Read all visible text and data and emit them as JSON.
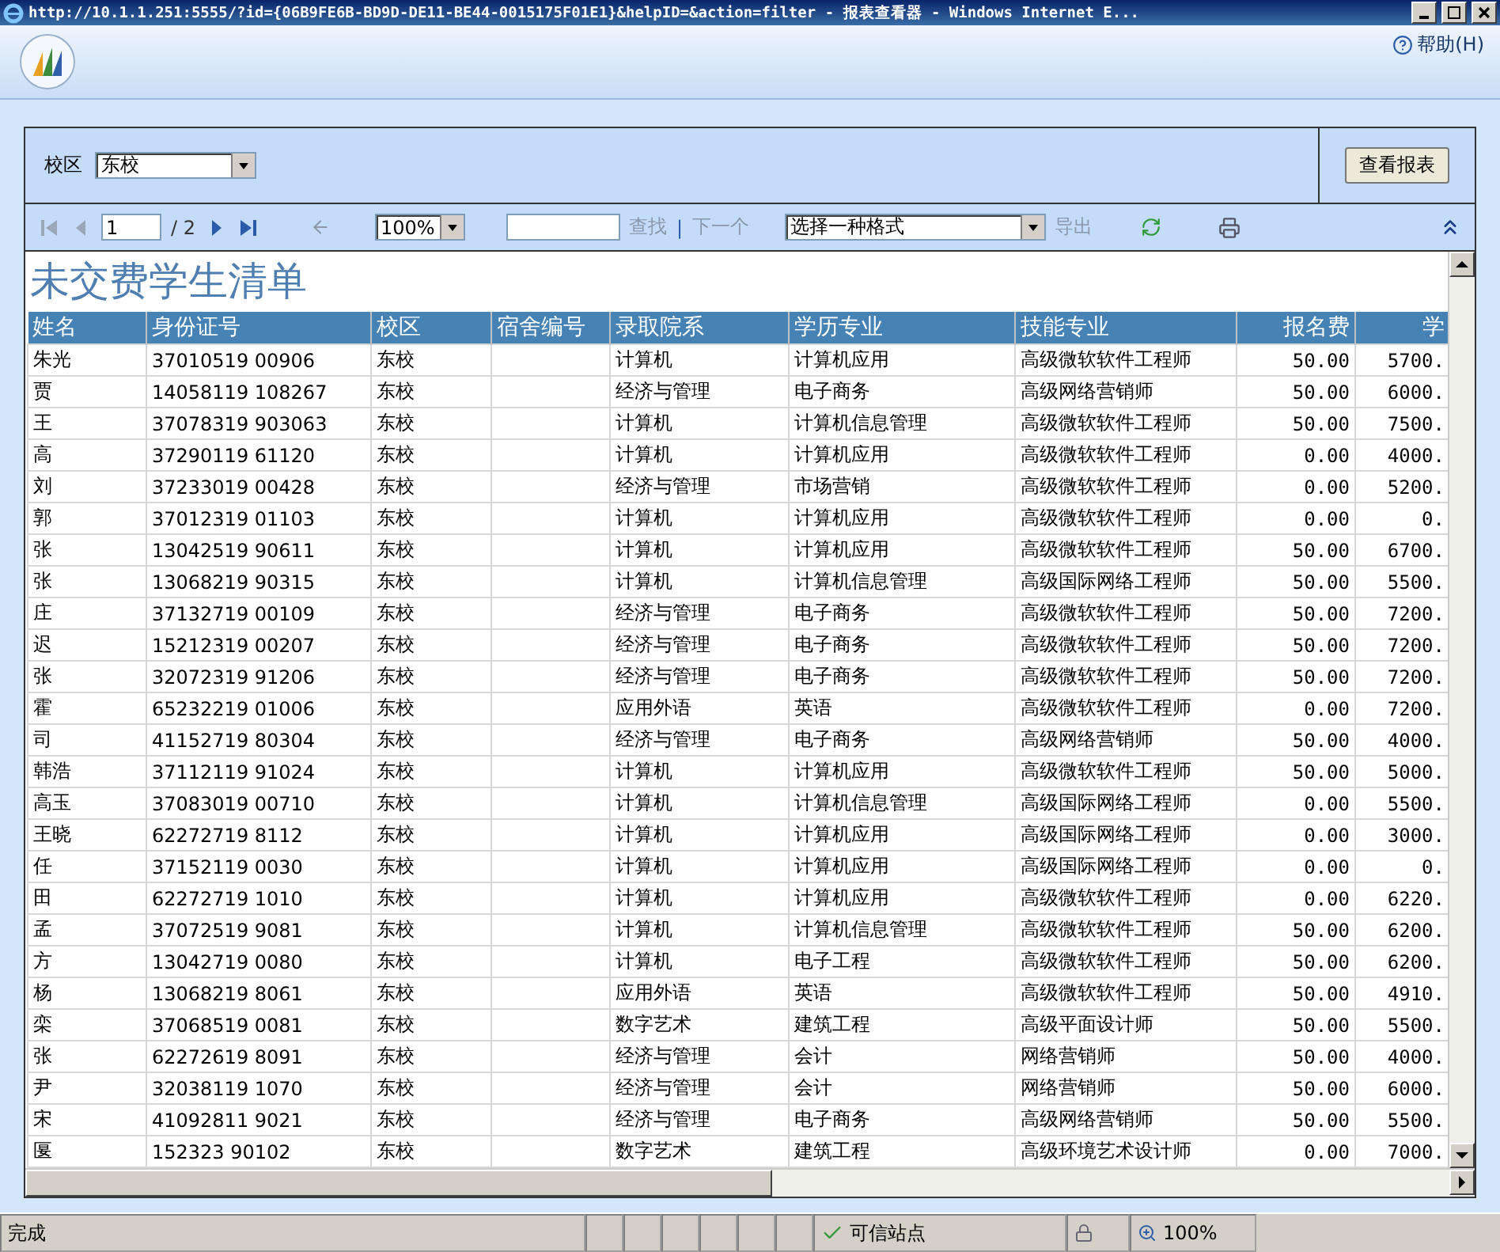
{
  "window": {
    "title": "http://10.1.1.251:5555/?id={06B9FE6B-BD9D-DE11-BE44-0015175F01E1}&helpID=&action=filter - 报表查看器 - Windows Internet E..."
  },
  "header": {
    "help": "帮助(H)"
  },
  "parameters": {
    "label": "校区",
    "value": "东校",
    "button": "查看报表"
  },
  "toolbar": {
    "page": "1",
    "page_total": "/ 2",
    "zoom": "100%",
    "find": "查找",
    "separator": "|",
    "find_next": "下一个",
    "format": "选择一种格式",
    "export": "导出",
    "nav": [
      {
        "kind": "first",
        "disabled": true
      },
      {
        "kind": "prev",
        "disabled": true
      },
      {
        "kind": "next",
        "disabled": false
      },
      {
        "kind": "last",
        "disabled": false
      }
    ]
  },
  "report": {
    "title": "未交费学生清单",
    "columns": [
      {
        "label": "姓名",
        "kind": "text"
      },
      {
        "label": "身份证号",
        "kind": "text"
      },
      {
        "label": "校区",
        "kind": "text"
      },
      {
        "label": "宿舍编号",
        "kind": "text"
      },
      {
        "label": "录取院系",
        "kind": "text"
      },
      {
        "label": "学历专业",
        "kind": "text"
      },
      {
        "label": "技能专业",
        "kind": "text"
      },
      {
        "label": "报名费",
        "kind": "numeric"
      },
      {
        "label": "学",
        "kind": "numeric"
      }
    ],
    "rows": [
      {
        "cells": [
          "朱光",
          "37010519 00906",
          "东校",
          "",
          "计算机",
          "计算机应用",
          "高级微软软件工程师",
          "50.00",
          "5700."
        ]
      },
      {
        "cells": [
          "贾",
          "14058119 108267",
          "东校",
          "",
          "经济与管理",
          "电子商务",
          "高级网络营销师",
          "50.00",
          "6000."
        ]
      },
      {
        "cells": [
          "王",
          "37078319 903063",
          "东校",
          "",
          "计算机",
          "计算机信息管理",
          "高级微软软件工程师",
          "50.00",
          "7500."
        ]
      },
      {
        "cells": [
          "高",
          "37290119 61120",
          "东校",
          "",
          "计算机",
          "计算机应用",
          "高级微软软件工程师",
          "0.00",
          "4000."
        ]
      },
      {
        "cells": [
          "刘",
          "37233019 00428",
          "东校",
          "",
          "经济与管理",
          "市场营销",
          "高级微软软件工程师",
          "0.00",
          "5200."
        ]
      },
      {
        "cells": [
          "郭",
          "37012319 01103",
          "东校",
          "",
          "计算机",
          "计算机应用",
          "高级微软软件工程师",
          "0.00",
          "0."
        ]
      },
      {
        "cells": [
          "张",
          "13042519 90611",
          "东校",
          "",
          "计算机",
          "计算机应用",
          "高级微软软件工程师",
          "50.00",
          "6700."
        ]
      },
      {
        "cells": [
          "张",
          "13068219 90315",
          "东校",
          "",
          "计算机",
          "计算机信息管理",
          "高级国际网络工程师",
          "50.00",
          "5500."
        ]
      },
      {
        "cells": [
          "庄",
          "37132719 00109",
          "东校",
          "",
          "经济与管理",
          "电子商务",
          "高级微软软件工程师",
          "50.00",
          "7200."
        ]
      },
      {
        "cells": [
          "迟",
          "15212319 00207",
          "东校",
          "",
          "经济与管理",
          "电子商务",
          "高级微软软件工程师",
          "50.00",
          "7200."
        ]
      },
      {
        "cells": [
          "张",
          "32072319 91206",
          "东校",
          "",
          "经济与管理",
          "电子商务",
          "高级微软软件工程师",
          "50.00",
          "7200."
        ]
      },
      {
        "cells": [
          "霍",
          "65232219 01006",
          "东校",
          "",
          "应用外语",
          "英语",
          "高级微软软件工程师",
          "0.00",
          "7200."
        ]
      },
      {
        "cells": [
          "司",
          "41152719 80304",
          "东校",
          "",
          "经济与管理",
          "电子商务",
          "高级网络营销师",
          "50.00",
          "4000."
        ]
      },
      {
        "cells": [
          "韩浩",
          "37112119 91024",
          "东校",
          "",
          "计算机",
          "计算机应用",
          "高级微软软件工程师",
          "50.00",
          "5000."
        ]
      },
      {
        "cells": [
          "高玉",
          "37083019 00710",
          "东校",
          "",
          "计算机",
          "计算机信息管理",
          "高级国际网络工程师",
          "0.00",
          "5500."
        ]
      },
      {
        "cells": [
          "王晓",
          "62272719 8112",
          "东校",
          "",
          "计算机",
          "计算机应用",
          "高级国际网络工程师",
          "0.00",
          "3000."
        ]
      },
      {
        "cells": [
          "任",
          "37152119 0030",
          "东校",
          "",
          "计算机",
          "计算机应用",
          "高级国际网络工程师",
          "0.00",
          "0."
        ]
      },
      {
        "cells": [
          "田",
          "62272719 1010",
          "东校",
          "",
          "计算机",
          "计算机应用",
          "高级微软软件工程师",
          "0.00",
          "6220."
        ]
      },
      {
        "cells": [
          "孟",
          "37072519 9081",
          "东校",
          "",
          "计算机",
          "计算机信息管理",
          "高级微软软件工程师",
          "50.00",
          "6200."
        ]
      },
      {
        "cells": [
          "方",
          "13042719 0080",
          "东校",
          "",
          "计算机",
          "电子工程",
          "高级微软软件工程师",
          "50.00",
          "6200."
        ]
      },
      {
        "cells": [
          "杨",
          "13068219 8061",
          "东校",
          "",
          "应用外语",
          "英语",
          "高级微软软件工程师",
          "50.00",
          "4910."
        ]
      },
      {
        "cells": [
          "栾",
          "37068519 0081",
          "东校",
          "",
          "数字艺术",
          "建筑工程",
          "高级平面设计师",
          "50.00",
          "5500."
        ]
      },
      {
        "cells": [
          "张",
          "62272619 8091",
          "东校",
          "",
          "经济与管理",
          "会计",
          "网络营销师",
          "50.00",
          "4000."
        ]
      },
      {
        "cells": [
          "尹",
          "32038119 1070",
          "东校",
          "",
          "经济与管理",
          "会计",
          "网络营销师",
          "50.00",
          "6000."
        ]
      },
      {
        "cells": [
          "宋",
          "41092811 9021",
          "东校",
          "",
          "经济与管理",
          "电子商务",
          "高级网络营销师",
          "50.00",
          "5500."
        ]
      },
      {
        "cells": [
          "匽",
          "152323 90102",
          "东校",
          "",
          "数字艺术",
          "建筑工程",
          "高级环境艺术设计师",
          "0.00",
          "7000."
        ]
      }
    ]
  },
  "status_bar": {
    "text": "完成",
    "zone": "可信站点",
    "zoom": "100%"
  }
}
